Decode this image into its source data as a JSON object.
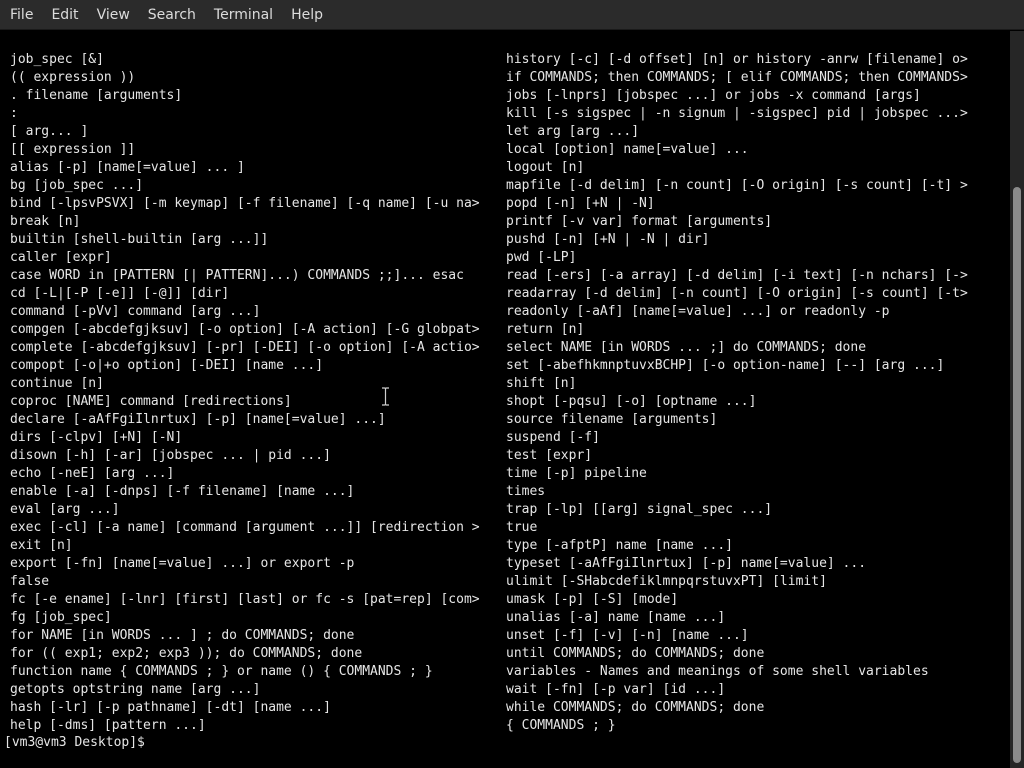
{
  "menubar": {
    "items": [
      "File",
      "Edit",
      "View",
      "Search",
      "Terminal",
      "Help"
    ]
  },
  "terminal": {
    "left_column": [
      "job_spec [&]",
      "(( expression ))",
      ". filename [arguments]",
      ":",
      "[ arg... ]",
      "[[ expression ]]",
      "alias [-p] [name[=value] ... ]",
      "bg [job_spec ...]",
      "bind [-lpsvPSVX] [-m keymap] [-f filename] [-q name] [-u na>",
      "break [n]",
      "builtin [shell-builtin [arg ...]]",
      "caller [expr]",
      "case WORD in [PATTERN [| PATTERN]...) COMMANDS ;;]... esac",
      "cd [-L|[-P [-e]] [-@]] [dir]",
      "command [-pVv] command [arg ...]",
      "compgen [-abcdefgjksuv] [-o option] [-A action] [-G globpat>",
      "complete [-abcdefgjksuv] [-pr] [-DEI] [-o option] [-A actio>",
      "compopt [-o|+o option] [-DEI] [name ...]",
      "continue [n]",
      "coproc [NAME] command [redirections]",
      "declare [-aAfFgiIlnrtux] [-p] [name[=value] ...]",
      "dirs [-clpv] [+N] [-N]",
      "disown [-h] [-ar] [jobspec ... | pid ...]",
      "echo [-neE] [arg ...]",
      "enable [-a] [-dnps] [-f filename] [name ...]",
      "eval [arg ...]",
      "exec [-cl] [-a name] [command [argument ...]] [redirection >",
      "exit [n]",
      "export [-fn] [name[=value] ...] or export -p",
      "false",
      "fc [-e ename] [-lnr] [first] [last] or fc -s [pat=rep] [com>",
      "fg [job_spec]",
      "for NAME [in WORDS ... ] ; do COMMANDS; done",
      "for (( exp1; exp2; exp3 )); do COMMANDS; done",
      "function name { COMMANDS ; } or name () { COMMANDS ; }",
      "getopts optstring name [arg ...]",
      "hash [-lr] [-p pathname] [-dt] [name ...]",
      "help [-dms] [pattern ...]"
    ],
    "right_column": [
      "history [-c] [-d offset] [n] or history -anrw [filename] o>",
      "if COMMANDS; then COMMANDS; [ elif COMMANDS; then COMMANDS>",
      "jobs [-lnprs] [jobspec ...] or jobs -x command [args]",
      "kill [-s sigspec | -n signum | -sigspec] pid | jobspec ...>",
      "let arg [arg ...]",
      "local [option] name[=value] ...",
      "logout [n]",
      "mapfile [-d delim] [-n count] [-O origin] [-s count] [-t] >",
      "popd [-n] [+N | -N]",
      "printf [-v var] format [arguments]",
      "pushd [-n] [+N | -N | dir]",
      "pwd [-LP]",
      "read [-ers] [-a array] [-d delim] [-i text] [-n nchars] [->",
      "readarray [-d delim] [-n count] [-O origin] [-s count] [-t>",
      "readonly [-aAf] [name[=value] ...] or readonly -p",
      "return [n]",
      "select NAME [in WORDS ... ;] do COMMANDS; done",
      "set [-abefhkmnptuvxBCHP] [-o option-name] [--] [arg ...]",
      "shift [n]",
      "shopt [-pqsu] [-o] [optname ...]",
      "source filename [arguments]",
      "suspend [-f]",
      "test [expr]",
      "time [-p] pipeline",
      "times",
      "trap [-lp] [[arg] signal_spec ...]",
      "true",
      "type [-afptP] name [name ...]",
      "typeset [-aAfFgiIlnrtux] [-p] name[=value] ...",
      "ulimit [-SHabcdefiklmnpqrstuvxPT] [limit]",
      "umask [-p] [-S] [mode]",
      "unalias [-a] name [name ...]",
      "unset [-f] [-v] [-n] [name ...]",
      "until COMMANDS; do COMMANDS; done",
      "variables - Names and meanings of some shell variables",
      "wait [-fn] [-p var] [id ...]",
      "while COMMANDS; do COMMANDS; done",
      "{ COMMANDS ; }"
    ],
    "prompt": "[vm3@vm3 Desktop]$ "
  },
  "icons": {
    "cursor": "text-cursor-icon"
  },
  "colors": {
    "background": "#000000",
    "text": "#e6e6e6",
    "menubar": "#2b2b2b",
    "menu_text": "#dcdcdc",
    "scroll_thumb": "#8a8a8a"
  }
}
